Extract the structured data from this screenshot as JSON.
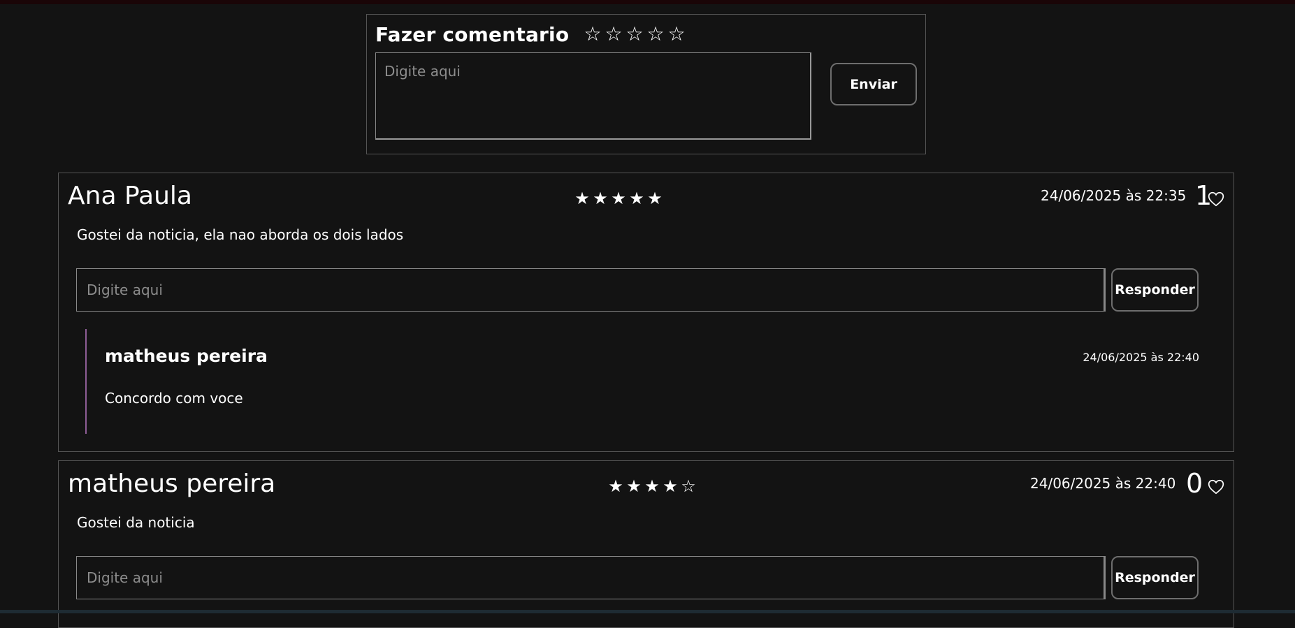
{
  "new_comment": {
    "title": "Fazer comentario",
    "stars": [
      "☆",
      "☆",
      "☆",
      "☆",
      "☆"
    ],
    "placeholder": "Digite aqui",
    "send_label": "Enviar"
  },
  "comments": [
    {
      "author": "Ana Paula",
      "stars": [
        "★",
        "★",
        "★",
        "★",
        "★"
      ],
      "rating": 5,
      "date": "24/06/2025 às 22:35",
      "likes": "1",
      "text": "Gostei da noticia, ela nao aborda os dois lados",
      "reply_placeholder": "Digite aqui",
      "reply_label": "Responder",
      "replies": [
        {
          "author": "matheus pereira",
          "date": "24/06/2025 às 22:40",
          "text": "Concordo com voce"
        }
      ]
    },
    {
      "author": "matheus pereira",
      "stars": [
        "★",
        "★",
        "★",
        "★",
        "☆"
      ],
      "rating": 4,
      "date": "24/06/2025 às 22:40",
      "likes": "0",
      "text": "Gostei da noticia",
      "reply_placeholder": "Digite aqui",
      "reply_label": "Responder"
    }
  ],
  "colors": {
    "background": "#131313",
    "border": "#555555",
    "reply_accent": "#8e5d96",
    "text": "#ffffff"
  }
}
